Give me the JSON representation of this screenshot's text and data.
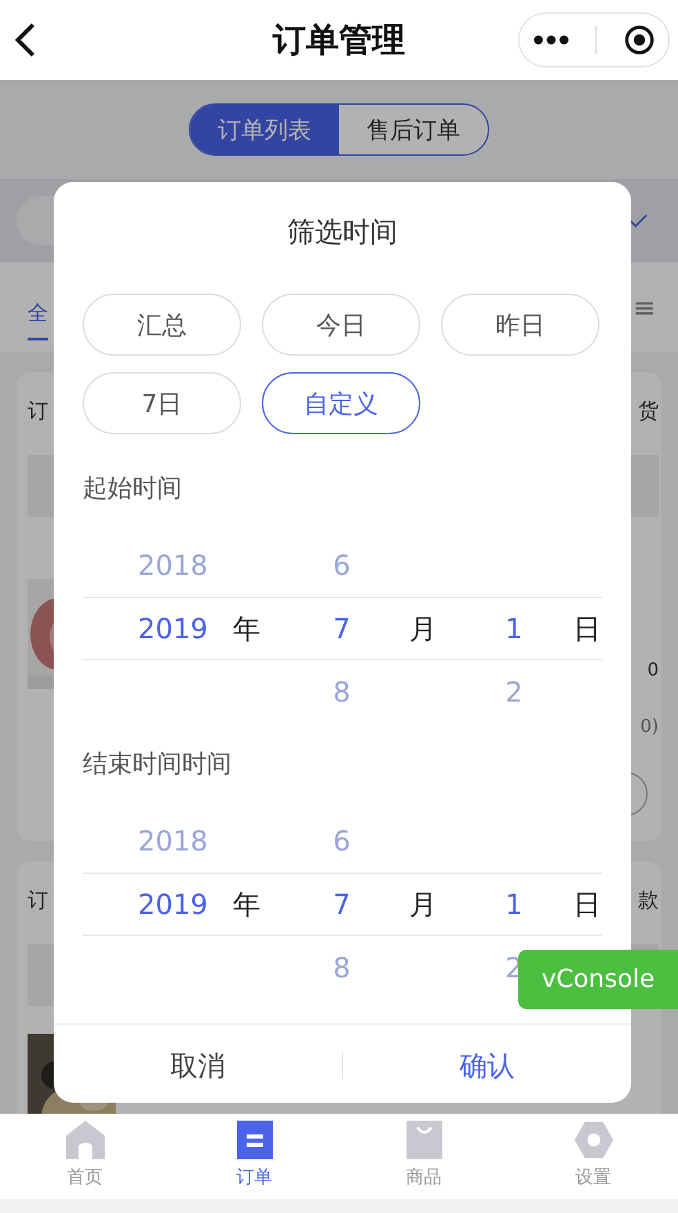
{
  "header": {
    "title": "订单管理"
  },
  "segments": [
    {
      "label": "订单列表",
      "selected": true
    },
    {
      "label": "售后订单",
      "selected": false
    }
  ],
  "tabs": {
    "first_visible": "全",
    "menu": "≡"
  },
  "cards": [
    {
      "left": "订",
      "right": "货",
      "lines": [
        "0",
        "0)"
      ]
    },
    {
      "left": "订",
      "right": "款"
    }
  ],
  "modal": {
    "title": "筛选时间",
    "presets": [
      {
        "label": "汇总",
        "selected": false
      },
      {
        "label": "今日",
        "selected": false
      },
      {
        "label": "昨日",
        "selected": false
      },
      {
        "label": "7日",
        "selected": false
      },
      {
        "label": "自定义",
        "selected": true
      }
    ],
    "pickers": [
      {
        "label": "起始时间",
        "rows": [
          {
            "year": "2018",
            "month": "6",
            "selected": false
          },
          {
            "year": "2019",
            "year_unit": "年",
            "month": "7",
            "month_unit": "月",
            "day": "1",
            "day_unit": "日",
            "selected": true
          },
          {
            "month": "8",
            "day": "2",
            "selected": false
          }
        ]
      },
      {
        "label": "结束时间时间",
        "rows": [
          {
            "year": "2018",
            "month": "6",
            "selected": false
          },
          {
            "year": "2019",
            "year_unit": "年",
            "month": "7",
            "month_unit": "月",
            "day": "1",
            "day_unit": "日",
            "selected": true
          },
          {
            "month": "8",
            "day": "2",
            "selected": false
          }
        ]
      }
    ],
    "cancel": "取消",
    "confirm": "确认"
  },
  "vconsole": "vConsole",
  "tabbar": [
    {
      "label": "首页",
      "kind": "home",
      "selected": false
    },
    {
      "label": "订单",
      "kind": "orders",
      "selected": true
    },
    {
      "label": "商品",
      "kind": "bag",
      "selected": false
    },
    {
      "label": "设置",
      "kind": "settings",
      "selected": false
    }
  ]
}
